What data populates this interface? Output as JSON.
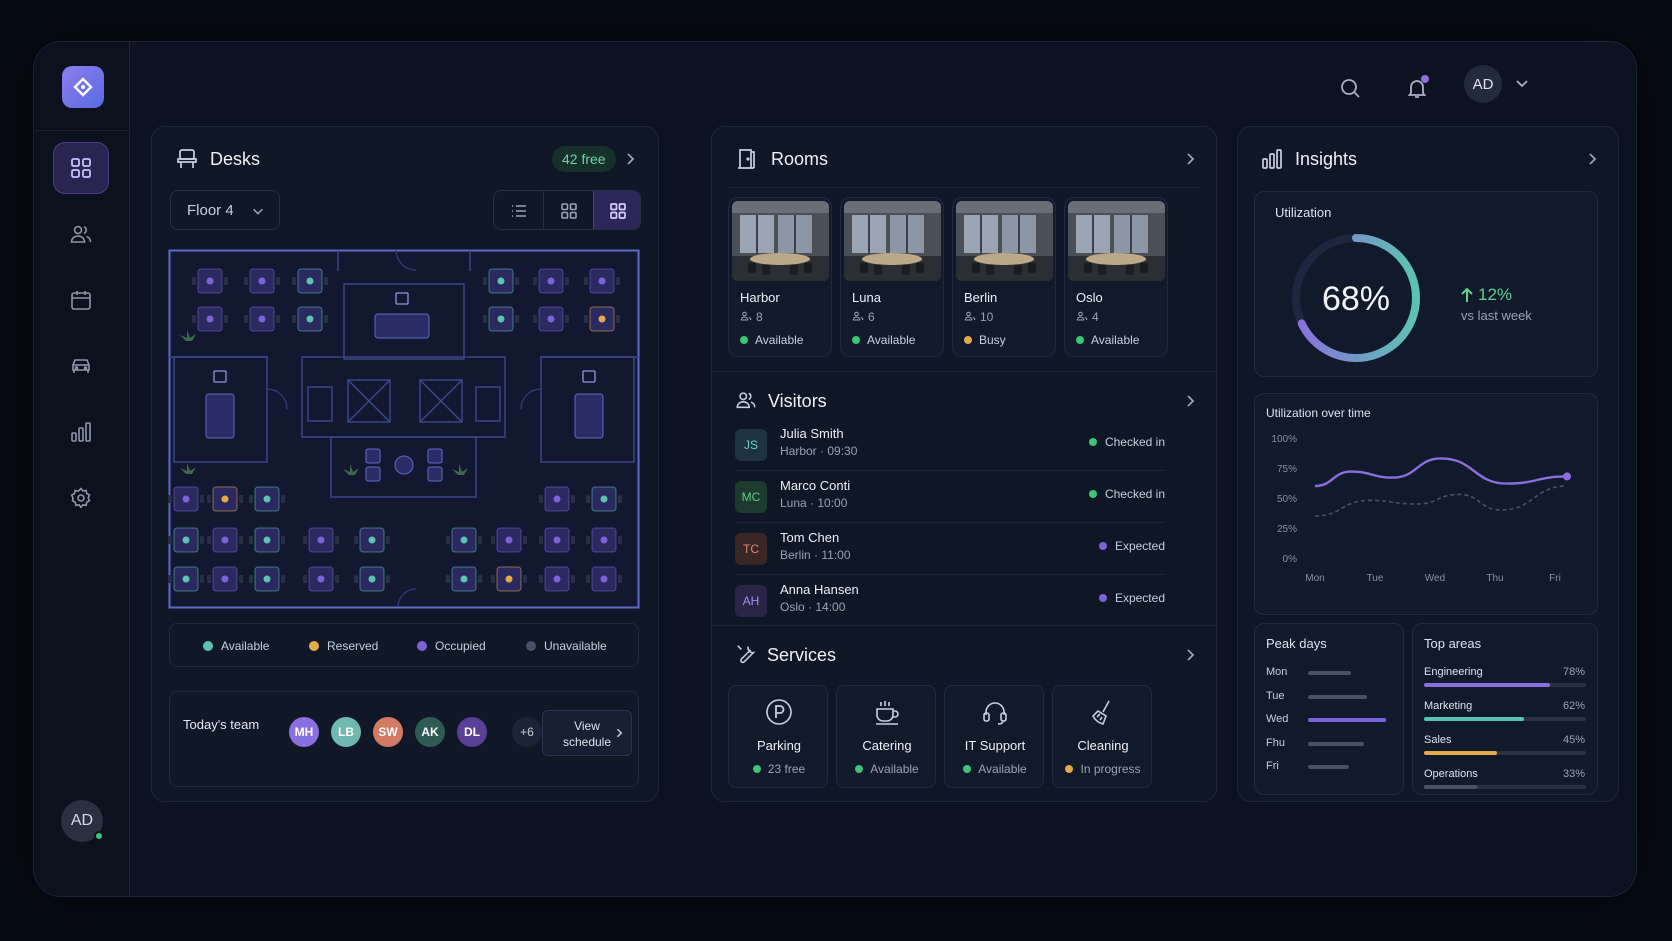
{
  "sidebar": {
    "user_initials": "AD"
  },
  "header": {
    "user_initials": "AD"
  },
  "desks": {
    "title": "Desks",
    "free_badge": "42 free",
    "floor": "Floor 4",
    "legend": [
      {
        "label": "Available",
        "color": "#5cc3b0"
      },
      {
        "label": "Reserved",
        "color": "#e6a94a"
      },
      {
        "label": "Occupied",
        "color": "#7a64d8"
      },
      {
        "label": "Unavailable",
        "color": "#4a5166"
      }
    ],
    "team_label": "Today's team",
    "team": [
      {
        "initials": "MH",
        "color": "#8a6fe0"
      },
      {
        "initials": "LB",
        "color": "#6fb8b0"
      },
      {
        "initials": "SW",
        "color": "#d27a63"
      },
      {
        "initials": "AK",
        "color": "#2f5a54"
      },
      {
        "initials": "DL",
        "color": "#5a3f96"
      }
    ],
    "team_more": "+6",
    "schedule_line1": "View",
    "schedule_line2": "schedule"
  },
  "rooms": {
    "title": "Rooms",
    "items": [
      {
        "name": "Harbor",
        "capacity": "8",
        "status": "Available",
        "status_color": "#3ec47a"
      },
      {
        "name": "Luna",
        "capacity": "6",
        "status": "Available",
        "status_color": "#3ec47a"
      },
      {
        "name": "Berlin",
        "capacity": "10",
        "status": "Busy",
        "status_color": "#e6a94a"
      },
      {
        "name": "Oslo",
        "capacity": "4",
        "status": "Available",
        "status_color": "#3ec47a"
      }
    ]
  },
  "visitors": {
    "title": "Visitors",
    "items": [
      {
        "initials": "JS",
        "name": "Julia Smith",
        "room": "Harbor",
        "time": "09:30",
        "status": "Checked in",
        "status_color": "#3ec47a",
        "avatar_bg": "#1d3440",
        "avatar_fg": "#6fc9c0"
      },
      {
        "initials": "MC",
        "name": "Marco Conti",
        "room": "Luna",
        "time": "10:00",
        "status": "Checked in",
        "status_color": "#3ec47a",
        "avatar_bg": "#1c3a2e",
        "avatar_fg": "#63c98e"
      },
      {
        "initials": "TC",
        "name": "Tom Chen",
        "room": "Berlin",
        "time": "11:00",
        "status": "Expected",
        "status_color": "#7a64d8",
        "avatar_bg": "#3a2624",
        "avatar_fg": "#d98a78"
      },
      {
        "initials": "AH",
        "name": "Anna Hansen",
        "room": "Oslo",
        "time": "14:00",
        "status": "Expected",
        "status_color": "#7a64d8",
        "avatar_bg": "#2a2446",
        "avatar_fg": "#a58ef0"
      }
    ]
  },
  "services": {
    "title": "Services",
    "items": [
      {
        "name": "Parking",
        "status": "23 free",
        "status_color": "#3ec47a",
        "icon": "parking-icon"
      },
      {
        "name": "Catering",
        "status": "Available",
        "status_color": "#3ec47a",
        "icon": "coffee-icon"
      },
      {
        "name": "IT Support",
        "status": "Available",
        "status_color": "#3ec47a",
        "icon": "headset-icon"
      },
      {
        "name": "Cleaning",
        "status": "In progress",
        "status_color": "#e6a94a",
        "icon": "broom-icon"
      }
    ]
  },
  "insights": {
    "title": "Insights",
    "utilization_label": "Utilization",
    "utilization_value": "68%",
    "utilization_fraction": 0.68,
    "trend_value": "12%",
    "trend_label": "vs last week",
    "over_time_label": "Utilization over time",
    "peak_days_label": "Peak days",
    "peak_days": [
      {
        "day": "Mon",
        "fraction": 0.55,
        "color": "#4a5166"
      },
      {
        "day": "Tue",
        "fraction": 0.75,
        "color": "#4a5166"
      },
      {
        "day": "Wed",
        "fraction": 1.0,
        "color": "#7a64d8"
      },
      {
        "day": "Fhu",
        "fraction": 0.72,
        "color": "#4a5166"
      },
      {
        "day": "Fri",
        "fraction": 0.52,
        "color": "#4a5166"
      }
    ],
    "top_areas_label": "Top areas",
    "top_areas": [
      {
        "name": "Engineering",
        "value": "78%",
        "fraction": 0.78,
        "color": "#8a6fe0"
      },
      {
        "name": "Marketing",
        "value": "62%",
        "fraction": 0.62,
        "color": "#5cc3b0"
      },
      {
        "name": "Sales",
        "value": "45%",
        "fraction": 0.45,
        "color": "#e6a94a"
      },
      {
        "name": "Operations",
        "value": "33%",
        "fraction": 0.33,
        "color": "#4a5166"
      }
    ]
  },
  "chart_data": {
    "type": "line",
    "title": "Utilization over time",
    "categories": [
      "Mon",
      "Tue",
      "Wed",
      "Thu",
      "Fri"
    ],
    "y_ticks": [
      "100%",
      "75%",
      "50%",
      "25%",
      "0%"
    ],
    "ylim": [
      0,
      100
    ],
    "series": [
      {
        "values": [
          60,
          72,
          67,
          83,
          62,
          68
        ],
        "x": [
          0,
          0.6,
          1.3,
          2.1,
          3.2,
          4.2
        ],
        "color": "#8a6fe0"
      },
      {
        "values": [
          35,
          48,
          45,
          53,
          40,
          60
        ],
        "x": [
          0,
          0.9,
          1.7,
          2.4,
          3.1,
          4.2
        ],
        "color": "#4a5166"
      }
    ]
  }
}
